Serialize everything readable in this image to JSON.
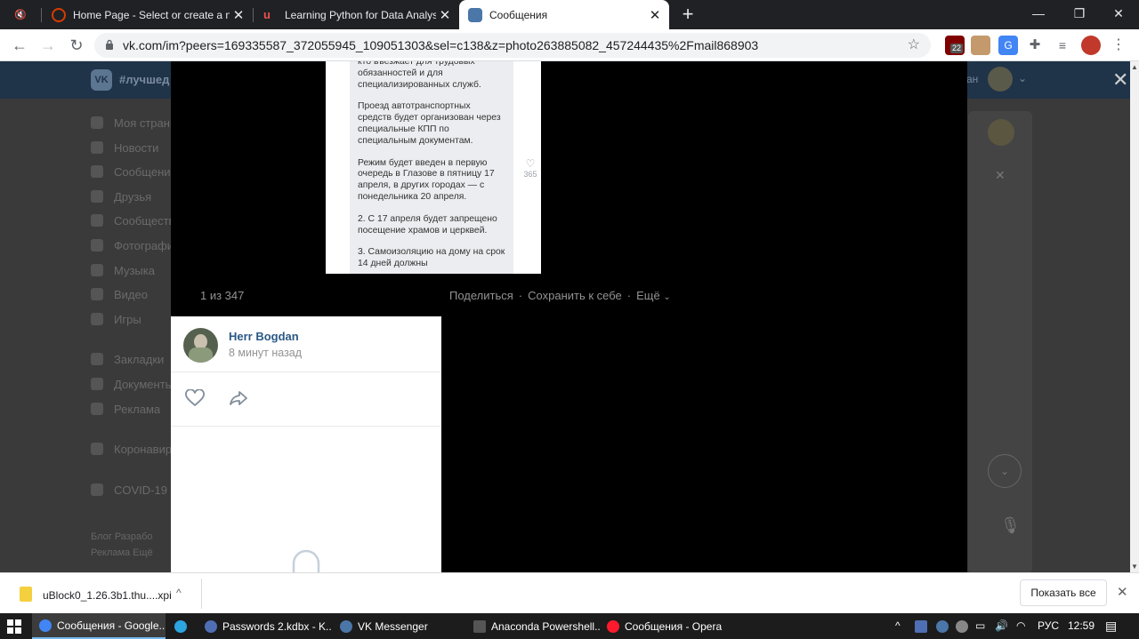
{
  "browser": {
    "tabs": [
      {
        "title": "Home Page - Select or create a note",
        "icon": "onenote-icon",
        "color": "#d83b01"
      },
      {
        "title": "Learning Python for Data Analysis and",
        "icon": "udemy-icon",
        "color": "#ec5252"
      },
      {
        "title": "Сообщения",
        "icon": "vk-messages-icon",
        "color": "#4a76a8",
        "active": true
      }
    ],
    "new_tab": "+",
    "window_controls": {
      "minimize": "—",
      "restore": "❐",
      "close": "✕"
    },
    "url": "vk.com/im?peers=169335587_372055945_109051303&sel=c138&z=photo263885082_457244435%2Fmail868903",
    "extensions": [
      {
        "name": "ublock-extension-icon",
        "badge": "22",
        "color": "#800000"
      },
      {
        "name": "cookie-extension-icon",
        "color": "#c49a6c"
      },
      {
        "name": "translate-extension-icon",
        "color": "#4285f4"
      },
      {
        "name": "extensions-puzzle-icon",
        "color": "#5f6368"
      },
      {
        "name": "media-control-icon",
        "color": "#5f6368"
      },
      {
        "name": "profile-avatar-icon",
        "color": "#c0392b"
      }
    ]
  },
  "vk_page": {
    "header_hashtag": "#лучшед",
    "header_user": "ан",
    "nav": [
      {
        "label": "Моя страни",
        "icon": "home-icon"
      },
      {
        "label": "Новости",
        "icon": "news-icon"
      },
      {
        "label": "Сообщения",
        "icon": "chat-icon"
      },
      {
        "label": "Друзья",
        "icon": "friends-icon"
      },
      {
        "label": "Сообщества",
        "icon": "groups-icon"
      },
      {
        "label": "Фотографи",
        "icon": "camera-icon"
      },
      {
        "label": "Музыка",
        "icon": "music-icon"
      },
      {
        "label": "Видео",
        "icon": "video-icon"
      },
      {
        "label": "Игры",
        "icon": "games-icon"
      },
      {
        "label": "",
        "icon": ""
      },
      {
        "label": "Закладки",
        "icon": "bookmark-icon"
      },
      {
        "label": "Документы",
        "icon": "document-icon"
      },
      {
        "label": "Реклама",
        "icon": "ads-icon"
      },
      {
        "label": "",
        "icon": ""
      },
      {
        "label": "Коронавир",
        "icon": "virus-icon"
      },
      {
        "label": "",
        "icon": ""
      },
      {
        "label": "COVID-19",
        "icon": "covid-icon"
      }
    ],
    "footer_line1": "Блог  Разрабо",
    "footer_line2": "Реклама  Ещё"
  },
  "viewer": {
    "photo_text": [
      "кто въезжает для трудовых обязанностей и для специализированных служб.",
      "Проезд автотранспортных средств будет организован через специальные КПП по специальным документам.",
      "Режим будет введен в первую очередь в Глазове в пятницу 17 апреля, в других городах — с понедельника 20 апреля.",
      "2. С 17 апреля будет запрещено посещение храмов и церквей.",
      "3. Самоизоляцию на дому на срок 14 дней должны"
    ],
    "photo_like_count": "365",
    "counter": "1 из 347",
    "actions": {
      "share": "Поделиться",
      "save": "Сохранить к себе",
      "more": "Ещё"
    },
    "author": {
      "name": "Herr Bogdan",
      "time": "8 минут назад"
    },
    "close": "✕"
  },
  "downloads": {
    "file": "uBlock0_1.26.3b1.thu....xpi",
    "show_all": "Показать все",
    "close": "✕"
  },
  "taskbar": {
    "items": [
      {
        "label": "Сообщения - Google...",
        "icon": "chrome-icon",
        "color": "#4285f4",
        "active": true
      },
      {
        "label": "",
        "icon": "telegram-icon",
        "color": "#2ca5e0"
      },
      {
        "label": "Passwords 2.kdbx - K...",
        "icon": "keepass-icon",
        "color": "#4f6fb5"
      },
      {
        "label": "VK Messenger",
        "icon": "vk-icon",
        "color": "#4a76a8"
      },
      {
        "label": "Anaconda Powershell...",
        "icon": "terminal-icon",
        "color": "#555555"
      },
      {
        "label": "Сообщения - Opera",
        "icon": "opera-icon",
        "color": "#ff1b2d"
      }
    ],
    "lang": "РУС",
    "clock": "12:59"
  }
}
